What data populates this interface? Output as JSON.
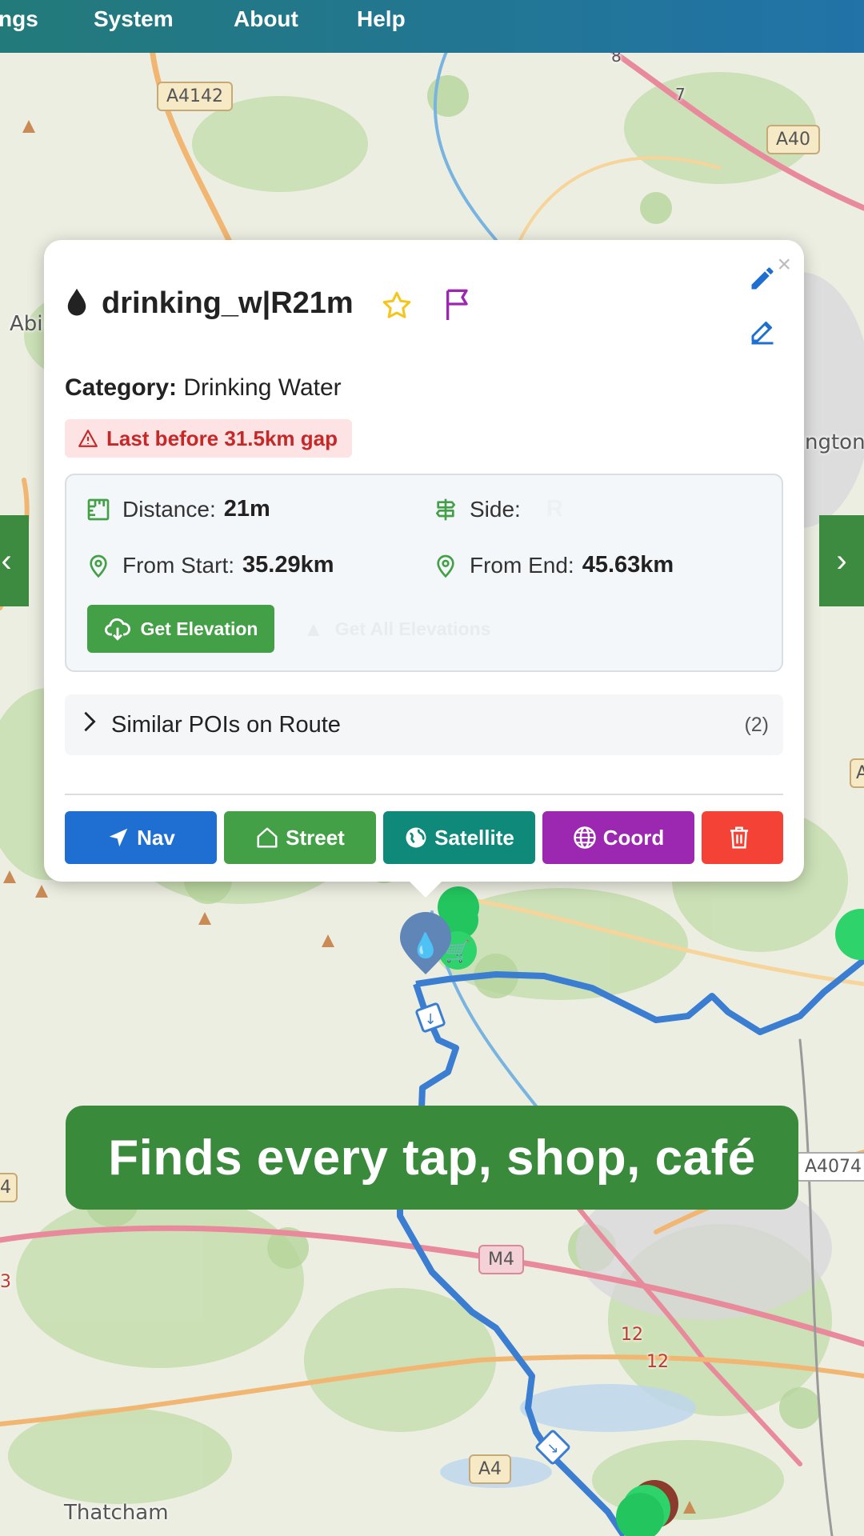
{
  "menu": {
    "items": [
      "ngs",
      "System",
      "About",
      "Help"
    ]
  },
  "map": {
    "road_labels": [
      "A4142",
      "A40",
      "A4074",
      "M4",
      "A4",
      "12",
      "12",
      "8",
      "7"
    ],
    "place_labels": [
      "Abi",
      "ngton",
      "Thatcham",
      "A",
      "4",
      "3"
    ]
  },
  "popup": {
    "title_icon": "water-drop-icon",
    "title": "drinking_w|R21m",
    "category_label": "Category:",
    "category_value": "Drinking Water",
    "gap_warning": "Last before 31.5km gap",
    "distance_label": "Distance:",
    "distance_value": "21m",
    "side_label": "Side:",
    "side_value": "R",
    "from_start_label": "From Start:",
    "from_start_value": "35.29km",
    "from_end_label": "From End:",
    "from_end_value": "45.63km",
    "get_elevation_label": "Get Elevation",
    "get_all_elevations_label": "Get All Elevations",
    "similar_label": "Similar POIs on Route",
    "similar_count": "(2)",
    "close_symbol": "×",
    "actions": {
      "nav": "Nav",
      "street": "Street",
      "satellite": "Satellite",
      "coord": "Coord"
    }
  },
  "nav_arrows": {
    "left": "‹",
    "right": "›"
  },
  "caption": "Finds every tap, shop, café",
  "colors": {
    "menubar_start": "#237a7a",
    "menubar_end": "#2173a8",
    "route": "#3a7dd1",
    "nav_btn": "#1e6fd1",
    "street_btn": "#43a047",
    "satellite_btn": "#0f8a7a",
    "coord_btn": "#9c27b0",
    "delete_btn": "#f44336",
    "caption_bg": "#3a8a3c",
    "warning": "#c62828"
  }
}
